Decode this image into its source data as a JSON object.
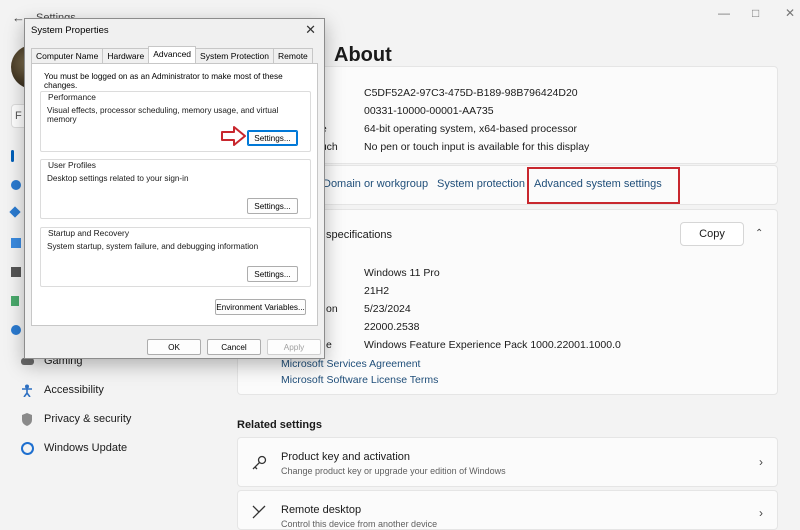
{
  "app": {
    "title": "Settings"
  },
  "page": {
    "title": "About"
  },
  "device_specs_partial": {
    "rows": [
      {
        "label": "",
        "value": "C5DF52A2-97C3-475D-B189-98B796424D20"
      },
      {
        "label": "D",
        "value": "00331-10000-00001-AA735"
      },
      {
        "label": "pe",
        "value": "64-bit operating system, x64-based processor"
      },
      {
        "label": "ouch",
        "value": "No pen or touch input is available for this display"
      }
    ]
  },
  "related_links": {
    "domain": "Domain or workgroup",
    "protection": "System protection",
    "advanced": "Advanced system settings"
  },
  "windows_specs": {
    "header": "specifications",
    "copy_label": "Copy",
    "rows": [
      {
        "label": "",
        "value": "Windows 11 Pro"
      },
      {
        "label": "",
        "value": "21H2"
      },
      {
        "label": "on",
        "value": "5/23/2024"
      },
      {
        "label": "",
        "value": "22000.2538"
      },
      {
        "label": "e",
        "value": "Windows Feature Experience Pack 1000.22001.1000.0"
      }
    ],
    "links": [
      "Microsoft Services Agreement",
      "Microsoft Software License Terms"
    ]
  },
  "sidebar": {
    "search_placeholder": "F",
    "items": [
      {
        "label": "Gaming",
        "icon": "gaming-icon"
      },
      {
        "label": "Accessibility",
        "icon": "accessibility-icon"
      },
      {
        "label": "Privacy & security",
        "icon": "shield-icon"
      },
      {
        "label": "Windows Update",
        "icon": "update-icon"
      }
    ]
  },
  "related_settings": {
    "heading": "Related settings",
    "items": [
      {
        "title": "Product key and activation",
        "subtitle": "Change product key or upgrade your edition of Windows",
        "icon": "key-icon"
      },
      {
        "title": "Remote desktop",
        "subtitle": "Control this device from another device",
        "icon": "remote-desktop-icon"
      }
    ]
  },
  "dialog": {
    "title": "System Properties",
    "tabs": [
      "Computer Name",
      "Hardware",
      "Advanced",
      "System Protection",
      "Remote"
    ],
    "active_tab": "Advanced",
    "admin_note": "You must be logged on as an Administrator to make most of these changes.",
    "groups": [
      {
        "title": "Performance",
        "desc": "Visual effects, processor scheduling, memory usage, and virtual memory",
        "button": "Settings..."
      },
      {
        "title": "User Profiles",
        "desc": "Desktop settings related to your sign-in",
        "button": "Settings..."
      },
      {
        "title": "Startup and Recovery",
        "desc": "System startup, system failure, and debugging information",
        "button": "Settings..."
      }
    ],
    "env_button": "Environment Variables...",
    "ok": "OK",
    "cancel": "Cancel",
    "apply": "Apply"
  },
  "colors": {
    "accent_link": "#1f4e79",
    "annotation_red": "#c8272e",
    "focus_blue": "#0078d7"
  }
}
